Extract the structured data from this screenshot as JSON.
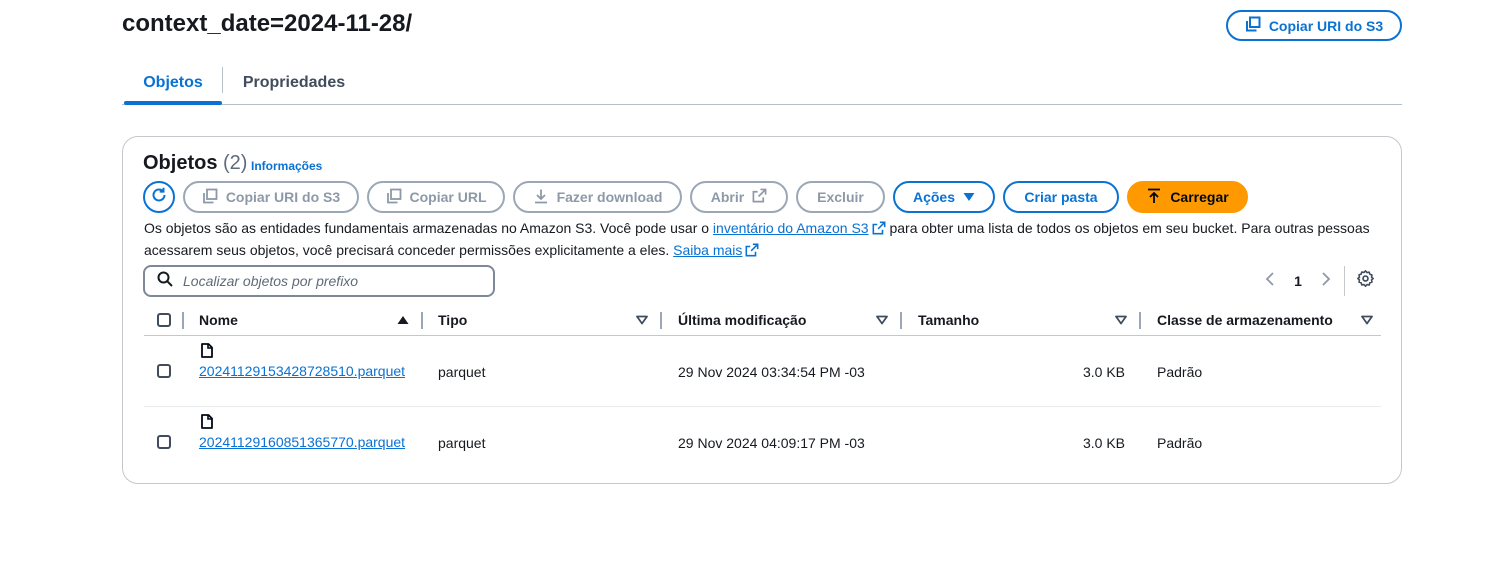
{
  "header": {
    "title": "context_date=2024-11-28/",
    "copy_uri_label": "Copiar URI do S3"
  },
  "tabs": [
    {
      "label": "Objetos",
      "active": true
    },
    {
      "label": "Propriedades",
      "active": false
    }
  ],
  "objects_panel": {
    "title": "Objetos",
    "count": "(2)",
    "info_label": "Informações",
    "buttons": {
      "copy_s3_uri": "Copiar URI do S3",
      "copy_url": "Copiar URL",
      "download": "Fazer download",
      "open": "Abrir",
      "delete": "Excluir",
      "actions": "Ações",
      "create_folder": "Criar pasta",
      "upload": "Carregar"
    },
    "description": {
      "part1": "Os objetos são as entidades fundamentais armazenadas no Amazon S3. Você pode usar o ",
      "link1": "inventário do Amazon S3",
      "part2": " para obter uma lista de todos os objetos em seu bucket. Para outras pessoas acessarem seus objetos, você precisará conceder permissões explicitamente a eles. ",
      "link2": "Saiba mais"
    },
    "search": {
      "placeholder": "Localizar objetos por prefixo",
      "value": ""
    },
    "pagination": {
      "current_page": "1"
    },
    "columns": [
      "Nome",
      "Tipo",
      "Última modificação",
      "Tamanho",
      "Classe de armazenamento"
    ],
    "rows": [
      {
        "name": "20241129153428728510.parquet",
        "type": "parquet",
        "modified": "29 Nov 2024 03:34:54 PM -03",
        "size": "3.0 KB",
        "storage_class": "Padrão"
      },
      {
        "name": "20241129160851365770.parquet",
        "type": "parquet",
        "modified": "29 Nov 2024 04:09:17 PM -03",
        "size": "3.0 KB",
        "storage_class": "Padrão"
      }
    ]
  },
  "colors": {
    "accent": "#0972d3",
    "primary_button": "#ff9900",
    "disabled": "#8d99a8",
    "text": "#16191f"
  },
  "icons": [
    "copy-icon",
    "refresh-icon",
    "download-icon",
    "external-link-icon",
    "caret-down-icon",
    "upload-icon",
    "search-icon",
    "chevron-left-icon",
    "chevron-right-icon",
    "settings-icon",
    "sort-ascending-icon",
    "sort-icon",
    "file-icon"
  ]
}
